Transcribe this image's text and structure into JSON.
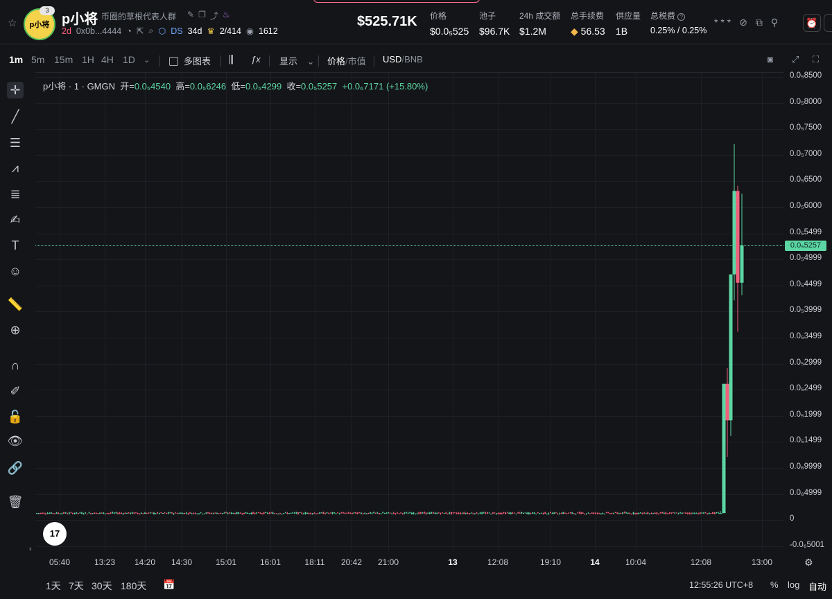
{
  "header": {
    "avatar_text": "p小将",
    "avatar_badge": "3",
    "token_name": "p小将",
    "description": "币圈的草根代表人群",
    "age": "2d",
    "address": "0x0b...4444",
    "ds_label": "DS",
    "ds_age": "34d",
    "holders_rank": "2/414",
    "views": "1612",
    "market_cap": "$525.71K",
    "stats": [
      {
        "label": "价格",
        "value": "$0.0₅525"
      },
      {
        "label": "池子",
        "value": "$96.7K"
      },
      {
        "label": "24h 成交额",
        "value": "$1.2M"
      },
      {
        "label": "总手续费",
        "value": "56.53"
      },
      {
        "label": "供应量",
        "value": "1B"
      },
      {
        "label": "总税费",
        "value": "0.25% / 0.25%"
      }
    ],
    "top_icons_text": "* * *"
  },
  "toolbar": {
    "timeframes": [
      "1m",
      "5m",
      "15m",
      "1H",
      "4H",
      "1D"
    ],
    "active_timeframe": "1m",
    "multi_chart": "多图表",
    "display": "显示",
    "price_label": "价格",
    "mcap_label": "市值",
    "currency_usd": "USD",
    "currency_bnb": "BNB"
  },
  "legend": {
    "symbol": "p小将 · 1 · GMGN",
    "open_label": "开=",
    "open": "0.0₅4540",
    "high_label": "高=",
    "high": "0.0₅6246",
    "low_label": "低=",
    "low": "0.0₅4299",
    "close_label": "收=",
    "close": "0.0₅5257",
    "change": "+0.0₆7171 (+15.80%)"
  },
  "yaxis": {
    "ticks": [
      "0.0₅8500",
      "0.0₅8000",
      "0.0₅7500",
      "0.0₅7000",
      "0.0₅6500",
      "0.0₅6000",
      "0.0₅5499",
      "0.0₅4999",
      "0.0₅4499",
      "0.0₅3999",
      "0.0₅3499",
      "0.0₅2999",
      "0.0₅2499",
      "0.0₅1999",
      "0.0₅1499",
      "0.0₆9999",
      "0.0₆4999",
      "0",
      "-0.0₆5001"
    ],
    "current_tag": "0.0₅5257"
  },
  "xaxis": {
    "ticks": [
      {
        "label": "05:40",
        "bold": false
      },
      {
        "label": "13:23",
        "bold": false
      },
      {
        "label": "14:20",
        "bold": false
      },
      {
        "label": "14:30",
        "bold": false
      },
      {
        "label": "15:01",
        "bold": false
      },
      {
        "label": "16:01",
        "bold": false
      },
      {
        "label": "18:11",
        "bold": false
      },
      {
        "label": "20:42",
        "bold": false
      },
      {
        "label": "21:00",
        "bold": false
      },
      {
        "label": "13",
        "bold": true
      },
      {
        "label": "12:08",
        "bold": false
      },
      {
        "label": "19:10",
        "bold": false
      },
      {
        "label": "14",
        "bold": true
      },
      {
        "label": "10:04",
        "bold": false
      },
      {
        "label": "12:08",
        "bold": false
      },
      {
        "label": "13:00",
        "bold": false
      }
    ]
  },
  "bottom": {
    "ranges": [
      "1天",
      "7天",
      "30天",
      "180天"
    ],
    "clock": "12:55:26 UTC+8",
    "percent": "%",
    "log": "log",
    "auto": "自动"
  },
  "logo_text": "17",
  "colors": {
    "up": "#5cd6a4",
    "down": "#f0607a",
    "bg": "#141518"
  },
  "chart_data": {
    "type": "candlestick",
    "title": "p小将 · 1 · GMGN",
    "ylim": [
      -5.001e-07,
      8.5e-06
    ],
    "recent_candles": [
      {
        "o": 1.2e-07,
        "h": 1.6e-07,
        "l": 1.2e-07,
        "c": 1.2e-07
      },
      {
        "o": 1.2e-07,
        "h": 2.6e-06,
        "l": 1.2e-07,
        "c": 2.6e-06
      },
      {
        "o": 2.6e-06,
        "h": 2.9e-06,
        "l": 1.2e-06,
        "c": 1.9e-06
      },
      {
        "o": 1.9e-06,
        "h": 4.7e-06,
        "l": 1.6e-06,
        "c": 4.7e-06
      },
      {
        "o": 4.7e-06,
        "h": 7.2e-06,
        "l": 4.2e-06,
        "c": 6.3e-06
      },
      {
        "o": 6.3e-06,
        "h": 6.4e-06,
        "l": 3.6e-06,
        "c": 4.54e-06
      },
      {
        "o": 4.54e-06,
        "h": 6.246e-06,
        "l": 4.299e-06,
        "c": 5.257e-06
      }
    ]
  }
}
